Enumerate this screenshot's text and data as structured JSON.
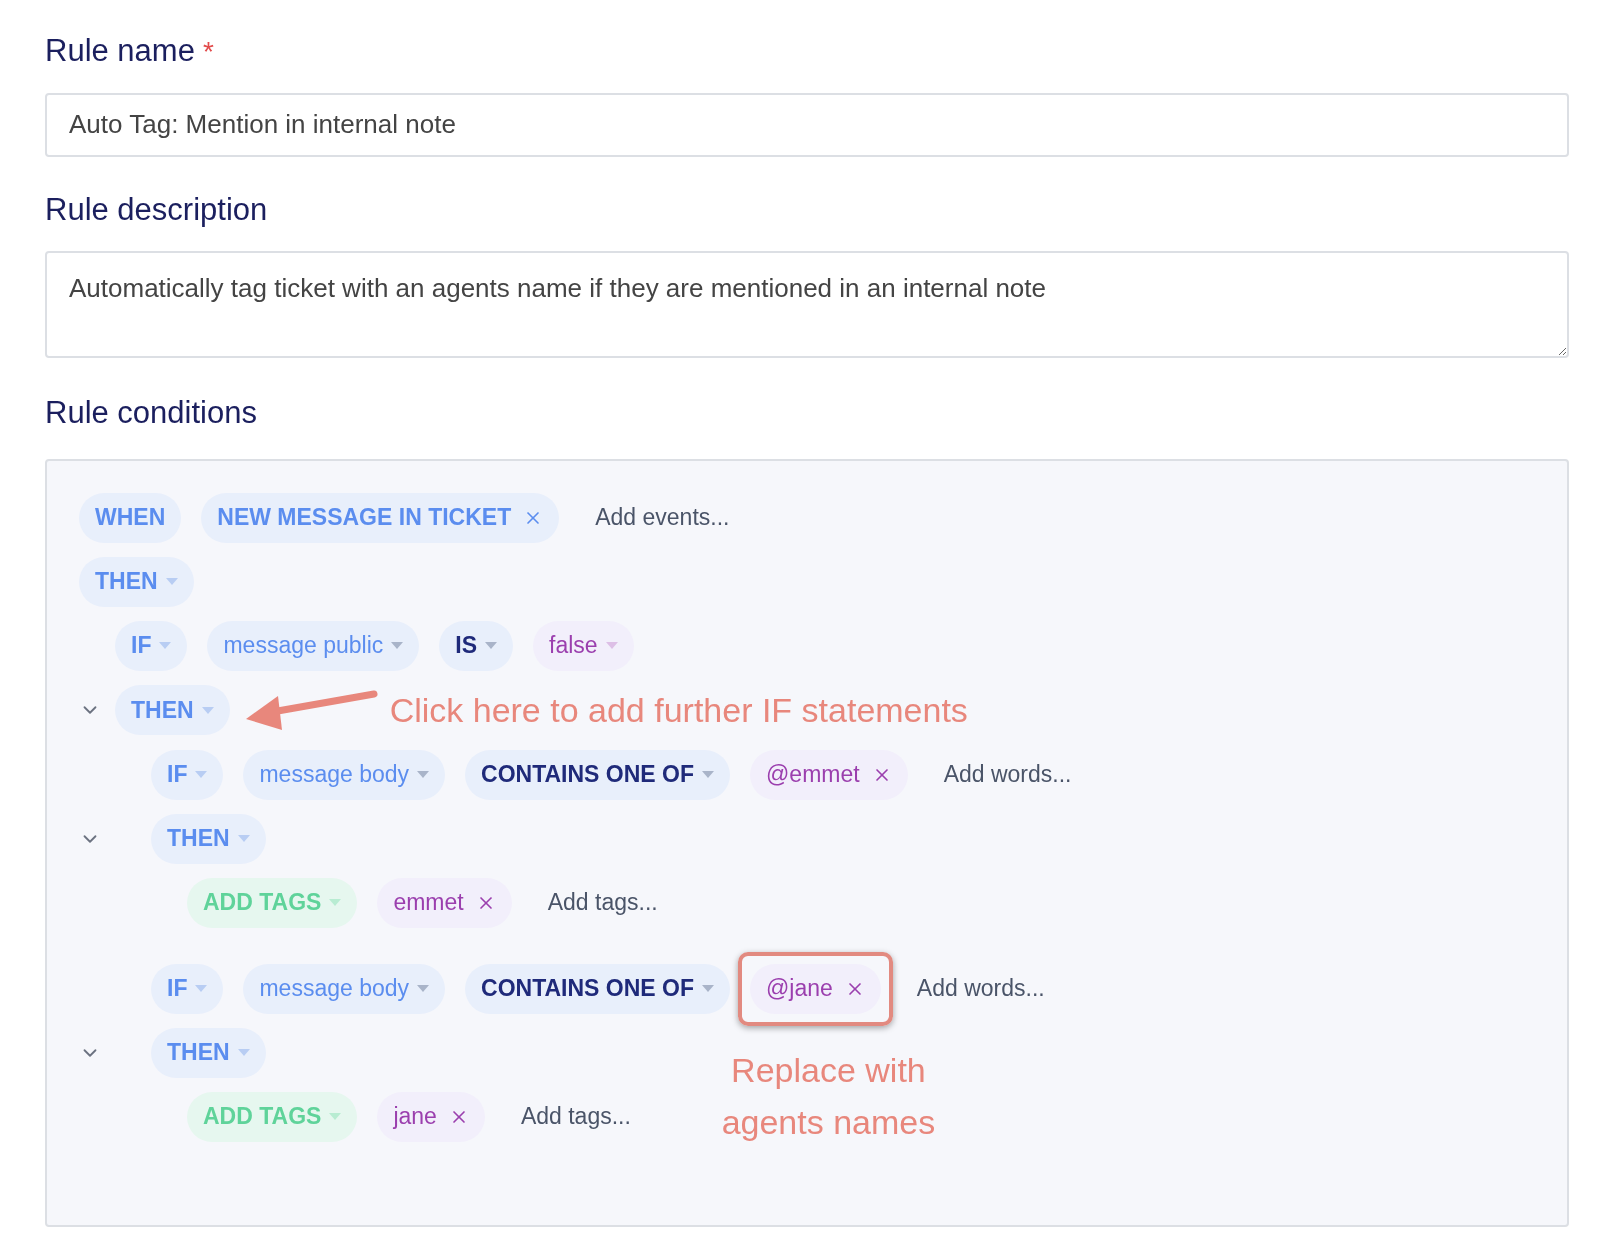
{
  "rule_name": {
    "label": "Rule name",
    "required_mark": "*",
    "value": "Auto Tag: Mention in internal note"
  },
  "rule_description": {
    "label": "Rule description",
    "value": "Automatically tag ticket with an agents name if they are mentioned in an internal note"
  },
  "rule_conditions": {
    "label": "Rule conditions",
    "nodes": [
      {
        "kind": "when",
        "label": "WHEN",
        "values": [
          {
            "label": "NEW MESSAGE IN TICKET",
            "highlight": false
          }
        ],
        "add_placeholder": "Add events..."
      },
      {
        "kind": "then",
        "label": "THEN",
        "children": [
          {
            "kind": "if",
            "label": "IF",
            "field": "message public",
            "operator": "IS",
            "value": "false"
          },
          {
            "kind": "then",
            "label": "THEN",
            "expanded": true,
            "annotation": "Click here to add further IF statements",
            "children": [
              {
                "kind": "if",
                "label": "IF",
                "field": "message body",
                "operator": "CONTAINS ONE OF",
                "values": [
                  {
                    "label": "@emmet",
                    "highlight": false
                  }
                ],
                "add_placeholder": "Add words..."
              },
              {
                "kind": "then",
                "label": "THEN",
                "expanded": true,
                "children": [
                  {
                    "kind": "action",
                    "label": "ADD TAGS",
                    "values": [
                      {
                        "label": "emmet",
                        "highlight": false
                      }
                    ],
                    "add_placeholder": "Add tags..."
                  }
                ]
              },
              {
                "kind": "if",
                "label": "IF",
                "field": "message body",
                "operator": "CONTAINS ONE OF",
                "values": [
                  {
                    "label": "@jane",
                    "highlight": true,
                    "annotation": "Replace with agents names"
                  }
                ],
                "add_placeholder": "Add words..."
              },
              {
                "kind": "then",
                "label": "THEN",
                "expanded": true,
                "children": [
                  {
                    "kind": "action",
                    "label": "ADD TAGS",
                    "values": [
                      {
                        "label": "jane",
                        "highlight": false
                      }
                    ],
                    "add_placeholder": "Add tags..."
                  }
                ]
              }
            ]
          }
        ]
      }
    ]
  }
}
